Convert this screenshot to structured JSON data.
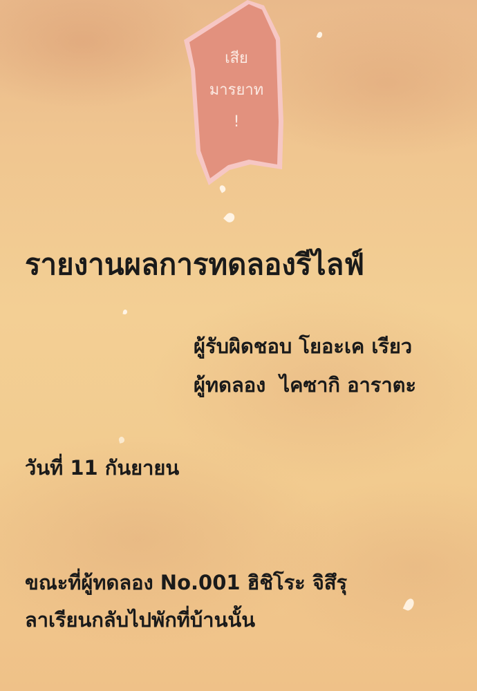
{
  "speech_bubble": {
    "lines": [
      "เสีย",
      "มารยาท",
      "!"
    ],
    "fill_color": "#e2917e",
    "border_color": "#f6c7c4"
  },
  "report": {
    "title": "รายงานผลการทดลองรีไลฟ์",
    "responsible": "ผู้รับผิดชอบ โยอะเค เรียว",
    "tester": "ผู้ทดลอง  ไคซากิ อาราตะ",
    "date": "วันที่ 11 กันยายน",
    "body_line_1": "ขณะที่ผู้ทดลอง No.001 ฮิชิโระ จิสึรุ",
    "body_line_2": "ลาเรียนกลับไปพักที่บ้านนั้น"
  },
  "colors": {
    "background": "#f1c890",
    "text": "#1a1a1a"
  }
}
